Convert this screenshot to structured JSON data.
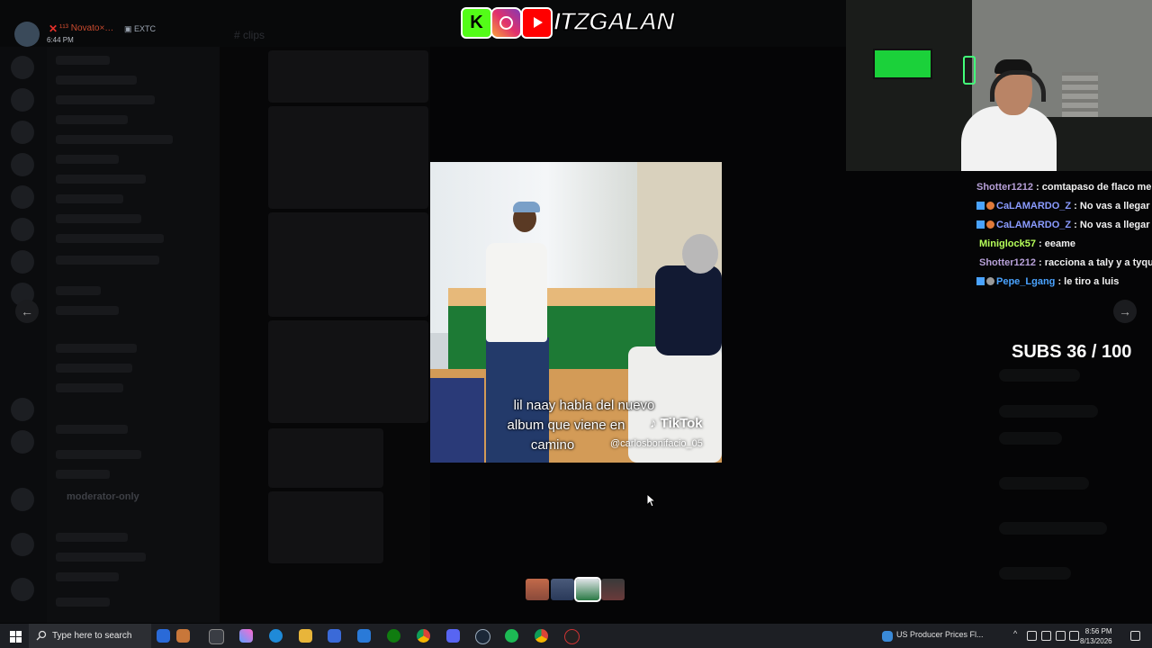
{
  "overlay": {
    "brand_name": "ITZGALAN",
    "kick_letter": "K"
  },
  "user_tag": {
    "name": "¹¹³ Novato×…",
    "badge": "EXTC",
    "time": "6:44 PM"
  },
  "background": {
    "channel_header": "# clips",
    "moderator_channel": "moderator-only"
  },
  "video": {
    "caption_line1": "lil naay habla del nuevo",
    "caption_line2": "album que viene en",
    "caption_line3": "camino",
    "tiktok_label": "TikTok",
    "tiktok_user": "@carlosbonifacio_05"
  },
  "nav": {
    "prev": "←",
    "next": "→"
  },
  "chat": [
    {
      "user": "Shotter1212",
      "text": " : comtapaso de flaco me",
      "color": "#b7a0d8",
      "badges": 0
    },
    {
      "user": "CaLAMARDO_Z",
      "text": " : No vas a llegar",
      "color": "#8a9bff",
      "badges": 2
    },
    {
      "user": "CaLAMARDO_Z",
      "text": " : No vas a llegar",
      "color": "#8a9bff",
      "badges": 2
    },
    {
      "user": "Miniglock57",
      "text": " : eeame",
      "color": "#b6ff5a",
      "badges": 0
    },
    {
      "user": "Shotter1212",
      "text": " : racciona a taly y a tyqu",
      "color": "#b7a0d8",
      "badges": 0
    },
    {
      "user": "Pepe_Lgang",
      "text": " : le tiro a luis",
      "color": "#4aa3ff",
      "badges": 2
    }
  ],
  "subs_goal": {
    "label": "SUBS 36 / 100",
    "current": 36,
    "goal": 100
  },
  "taskbar": {
    "search_placeholder": "Type here to search",
    "news": "US Producer Prices Fl...",
    "time": "8:56 PM",
    "date": "8/13/2026"
  },
  "colors": {
    "kick": "#53fc18",
    "youtube": "#ff0000",
    "taskbar": "#1d1f24"
  }
}
